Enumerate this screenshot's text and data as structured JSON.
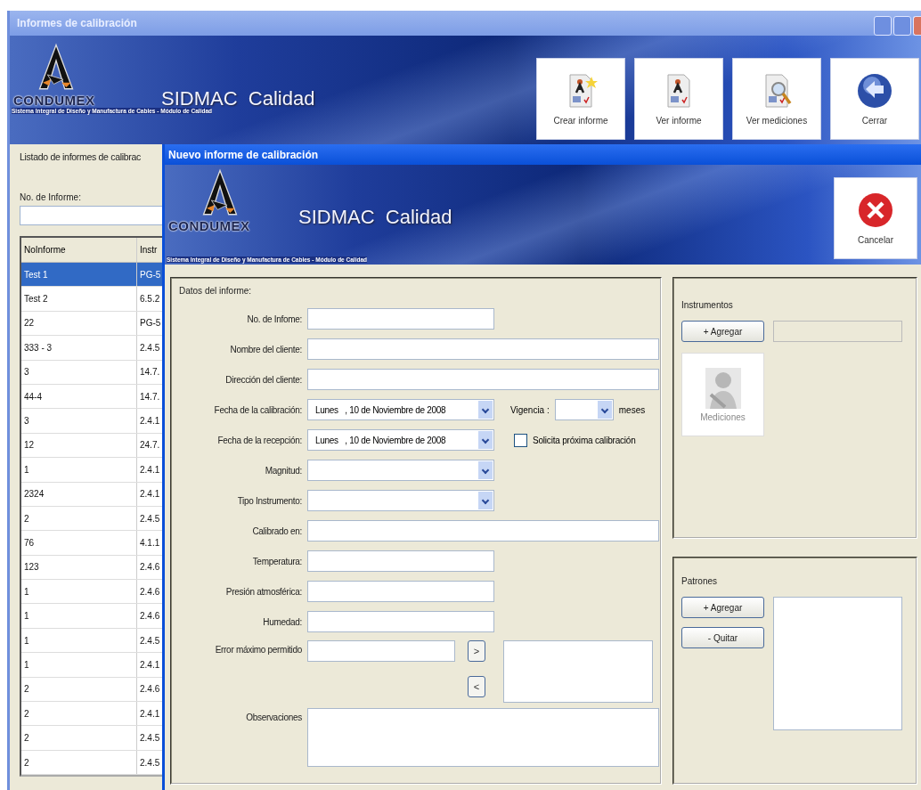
{
  "window": {
    "title": "Informes de calibración"
  },
  "banner": {
    "title": "SIDMAC  Calidad",
    "brand": "CONDUMEX",
    "tagline": "Sistema Integral de Diseño y Manufactura de Cables - Módulo de Calidad"
  },
  "toolbar": [
    {
      "label": "Crear informe",
      "kind": "new-report"
    },
    {
      "label": "Ver informe",
      "kind": "report"
    },
    {
      "label": "Ver mediciones",
      "kind": "search-report"
    },
    {
      "label": "Cerrar",
      "kind": "back"
    }
  ],
  "list_panel": {
    "title": "Listado de informes de calibrac",
    "search_label": "No. de Informe:",
    "columns": [
      "NoInforme",
      "Instr"
    ],
    "rows": [
      {
        "cells": [
          "Test 1",
          "PG-5"
        ],
        "selected": true
      },
      {
        "cells": [
          "Test 2",
          "6.5.2"
        ],
        "selected": false
      },
      {
        "cells": [
          "22",
          "PG-5"
        ],
        "selected": false
      },
      {
        "cells": [
          "333 - 3",
          "2.4.5"
        ],
        "selected": false
      },
      {
        "cells": [
          "3",
          "14.7."
        ],
        "selected": false
      },
      {
        "cells": [
          "44-4",
          "14.7."
        ],
        "selected": false
      },
      {
        "cells": [
          "3",
          "2.4.1"
        ],
        "selected": false
      },
      {
        "cells": [
          "12",
          "24.7."
        ],
        "selected": false
      },
      {
        "cells": [
          "1",
          "2.4.1"
        ],
        "selected": false
      },
      {
        "cells": [
          "2324",
          "2.4.1"
        ],
        "selected": false
      },
      {
        "cells": [
          "2",
          "2.4.5"
        ],
        "selected": false
      },
      {
        "cells": [
          "76",
          "4.1.1"
        ],
        "selected": false
      },
      {
        "cells": [
          "123",
          "2.4.6"
        ],
        "selected": false
      },
      {
        "cells": [
          "1",
          "2.4.6"
        ],
        "selected": false
      },
      {
        "cells": [
          "1",
          "2.4.6"
        ],
        "selected": false
      },
      {
        "cells": [
          "1",
          "2.4.5"
        ],
        "selected": false
      },
      {
        "cells": [
          "1",
          "2.4.1"
        ],
        "selected": false
      },
      {
        "cells": [
          "2",
          "2.4.6"
        ],
        "selected": false
      },
      {
        "cells": [
          "2",
          "2.4.1"
        ],
        "selected": false
      },
      {
        "cells": [
          "2",
          "2.4.5"
        ],
        "selected": false
      },
      {
        "cells": [
          "2",
          "2.4.5"
        ],
        "selected": false
      }
    ]
  },
  "dialog": {
    "title": "Nuevo informe de calibración",
    "banner": {
      "title": "SIDMAC  Calidad",
      "brand": "CONDUMEX",
      "tagline": "Sistema Integral de Diseño y Manufactura de Cables - Módulo de Calidad"
    },
    "cancel_button": "Cancelar",
    "form": {
      "title": "Datos del informe:",
      "fields": [
        {
          "label": "No. de Infome:",
          "kind": "text"
        },
        {
          "label": "Nombre del cliente:",
          "kind": "wide"
        },
        {
          "label": "Dirección del cliente:",
          "kind": "wide"
        },
        {
          "label": "Fecha de la calibración:",
          "kind": "date",
          "value": "Lunes   , 10 de Noviembre de 2008",
          "extra": {
            "kind": "select-unit",
            "label": "Vigencia :",
            "unit": "meses"
          }
        },
        {
          "label": "Fecha de la recepción:",
          "kind": "date",
          "value": "Lunes   , 10 de Noviembre de 2008",
          "extra": {
            "kind": "checkbox",
            "label": "Solicita próxima calibración",
            "checked": false
          }
        },
        {
          "label": "Magnitud:",
          "kind": "select"
        },
        {
          "label": "Tipo Instrumento:",
          "kind": "select"
        },
        {
          "label": "Calibrado en:",
          "kind": "wide"
        },
        {
          "label": "Temperatura:",
          "kind": "text"
        },
        {
          "label": "Presión atmosférica:",
          "kind": "text"
        },
        {
          "label": "Humedad:",
          "kind": "text"
        },
        {
          "label": "Error máximo permitido",
          "kind": "transfer",
          "add": ">",
          "remove": "<"
        },
        {
          "label": "Observaciones",
          "kind": "textarea"
        }
      ]
    },
    "instruments": {
      "title": "Instrumentos",
      "add_button": "+ Agregar",
      "tile": {
        "label": "Mediciones",
        "disabled": true
      }
    },
    "standards": {
      "title": "Patrones",
      "add_button": "+ Agregar",
      "remove_button": "- Quitar"
    }
  }
}
